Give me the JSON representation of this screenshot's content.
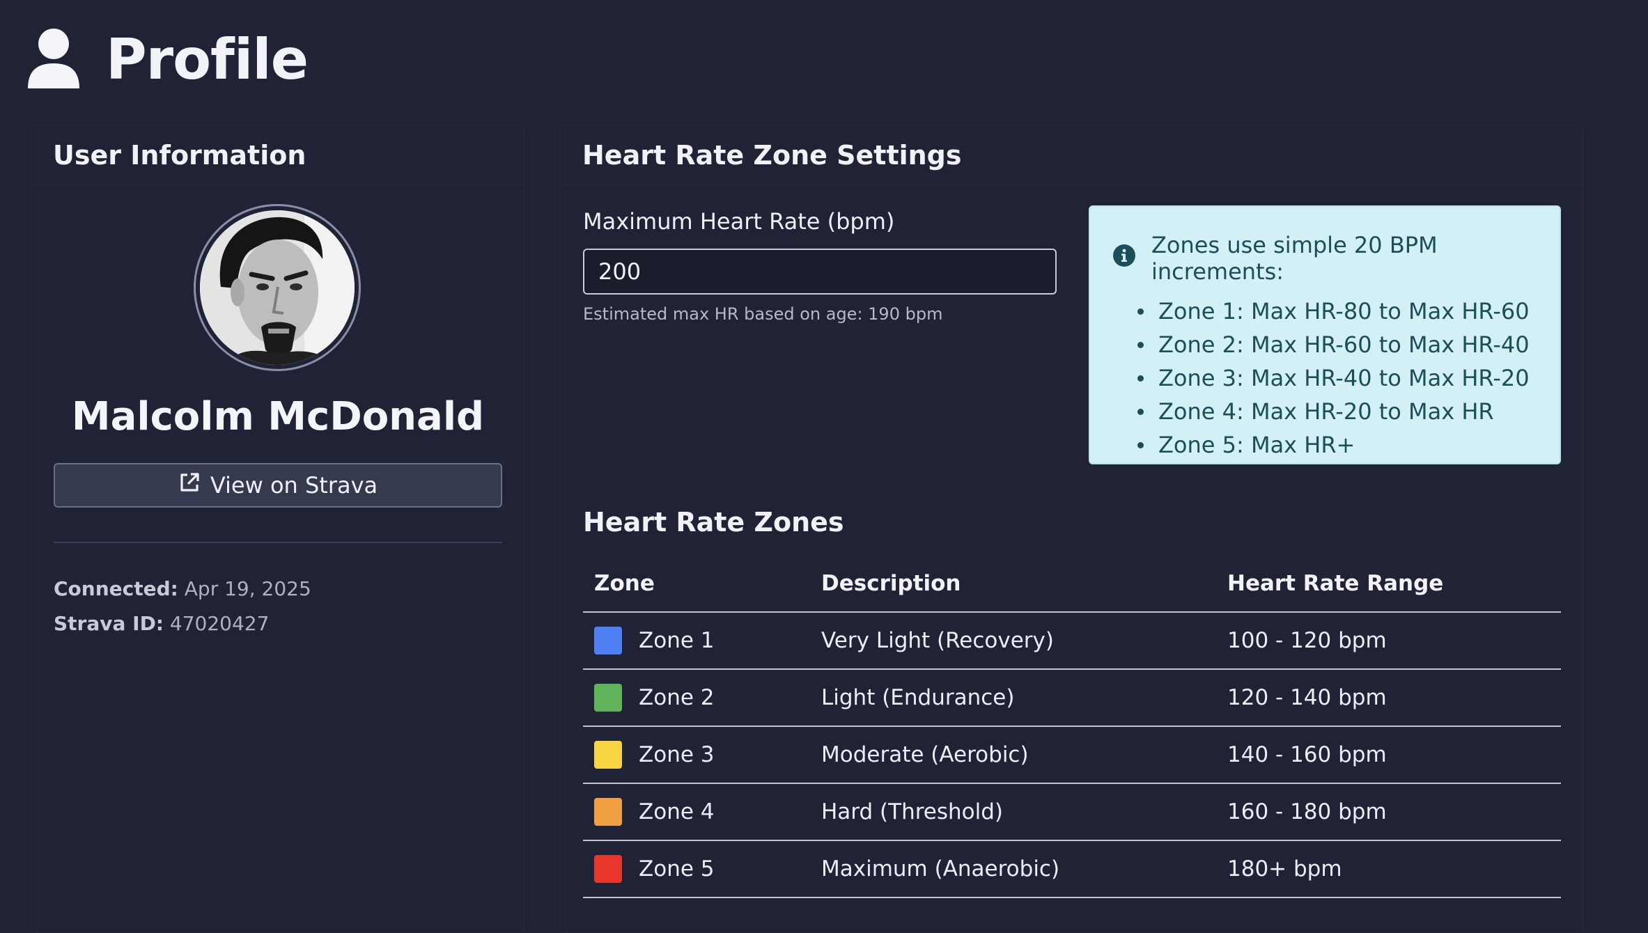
{
  "page": {
    "title": "Profile",
    "title_icon": "user-icon"
  },
  "user_card": {
    "heading": "User Information",
    "name": "Malcolm McDonald",
    "strava_button": {
      "label": "View on Strava",
      "icon": "external-link-icon"
    },
    "connected_label": "Connected:",
    "connected_value": "Apr 19, 2025",
    "strava_id_label": "Strava ID:",
    "strava_id_value": "47020427"
  },
  "hr_settings": {
    "heading": "Heart Rate Zone Settings",
    "max_hr_label": "Maximum Heart Rate (bpm)",
    "max_hr_value": "200",
    "help_text": "Estimated max HR based on age: 190 bpm",
    "info": {
      "icon": "info-circle-icon",
      "title": "Zones use simple 20 BPM increments:",
      "items": [
        "Zone 1: Max HR-80 to Max HR-60",
        "Zone 2: Max HR-60 to Max HR-40",
        "Zone 3: Max HR-40 to Max HR-20",
        "Zone 4: Max HR-20 to Max HR",
        "Zone 5: Max HR+"
      ]
    }
  },
  "zones": {
    "heading": "Heart Rate Zones",
    "columns": [
      "Zone",
      "Description",
      "Heart Rate Range"
    ],
    "rows": [
      {
        "zone": "Zone 1",
        "description": "Very Light (Recovery)",
        "range": "100 - 120 bpm",
        "color": "#4f7ff2"
      },
      {
        "zone": "Zone 2",
        "description": "Light (Endurance)",
        "range": "120 - 140 bpm",
        "color": "#60b35a"
      },
      {
        "zone": "Zone 3",
        "description": "Moderate (Aerobic)",
        "range": "140 - 160 bpm",
        "color": "#f8d443"
      },
      {
        "zone": "Zone 4",
        "description": "Hard (Threshold)",
        "range": "160 - 180 bpm",
        "color": "#f0a040"
      },
      {
        "zone": "Zone 5",
        "description": "Maximum (Anaerobic)",
        "range": "180+ bpm",
        "color": "#e8372a"
      }
    ]
  }
}
